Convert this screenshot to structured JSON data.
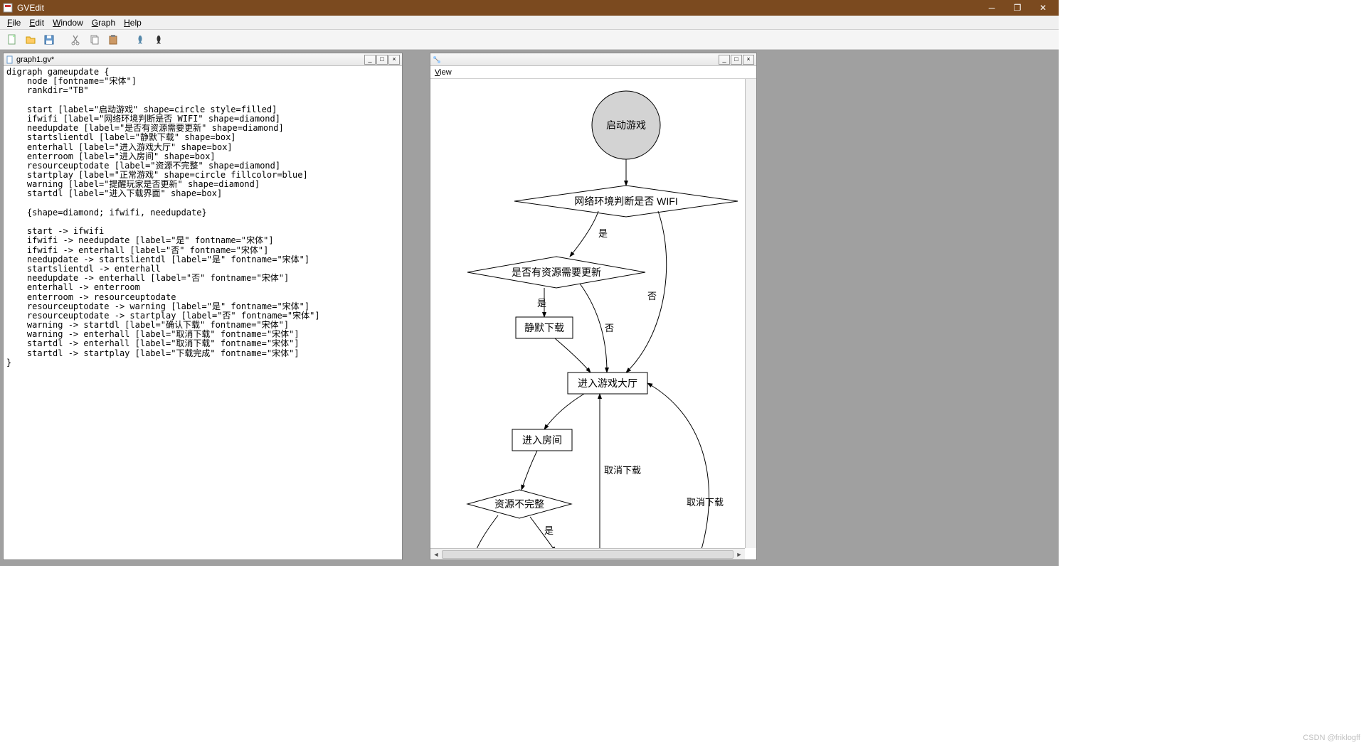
{
  "app": {
    "title": "GVEdit"
  },
  "menu": {
    "file": "File",
    "edit": "Edit",
    "window": "Window",
    "graph": "Graph",
    "help": "Help"
  },
  "editor": {
    "tab_title": "graph1.gv*",
    "code": "digraph gameupdate {\n    node [fontname=\"宋体\"]\n    rankdir=\"TB\"\n\n    start [label=\"启动游戏\" shape=circle style=filled]\n    ifwifi [label=\"网络环境判断是否 WIFI\" shape=diamond]\n    needupdate [label=\"是否有资源需要更新\" shape=diamond]\n    startslientdl [label=\"静默下载\" shape=box]\n    enterhall [label=\"进入游戏大厅\" shape=box]\n    enterroom [label=\"进入房间\" shape=box]\n    resourceuptodate [label=\"资源不完整\" shape=diamond]\n    startplay [label=\"正常游戏\" shape=circle fillcolor=blue]\n    warning [label=\"提醒玩家是否更新\" shape=diamond]\n    startdl [label=\"进入下载界面\" shape=box]\n\n    {shape=diamond; ifwifi, needupdate}\n\n    start -> ifwifi\n    ifwifi -> needupdate [label=\"是\" fontname=\"宋体\"]\n    ifwifi -> enterhall [label=\"否\" fontname=\"宋体\"]\n    needupdate -> startslientdl [label=\"是\" fontname=\"宋体\"]\n    startslientdl -> enterhall\n    needupdate -> enterhall [label=\"否\" fontname=\"宋体\"]\n    enterhall -> enterroom\n    enterroom -> resourceuptodate\n    resourceuptodate -> warning [label=\"是\" fontname=\"宋体\"]\n    resourceuptodate -> startplay [label=\"否\" fontname=\"宋体\"]\n    warning -> startdl [label=\"确认下载\" fontname=\"宋体\"]\n    warning -> enterhall [label=\"取消下载\" fontname=\"宋体\"]\n    startdl -> enterhall [label=\"取消下载\" fontname=\"宋体\"]\n    startdl -> startplay [label=\"下载完成\" fontname=\"宋体\"]\n}"
  },
  "viewer": {
    "menu_view": "View"
  },
  "graph": {
    "nodes": {
      "start": "启动游戏",
      "ifwifi": "网络环境判断是否 WIFI",
      "needupdate": "是否有资源需要更新",
      "startslientdl": "静默下载",
      "enterhall": "进入游戏大厅",
      "enterroom": "进入房间",
      "resourceuptodate": "资源不完整"
    },
    "edges": {
      "yes1": "是",
      "no1": "否",
      "yes2": "是",
      "no2": "否",
      "yes3": "是",
      "cancel1": "取消下载",
      "cancel2": "取消下载"
    }
  },
  "watermark": "CSDN @friklogff"
}
